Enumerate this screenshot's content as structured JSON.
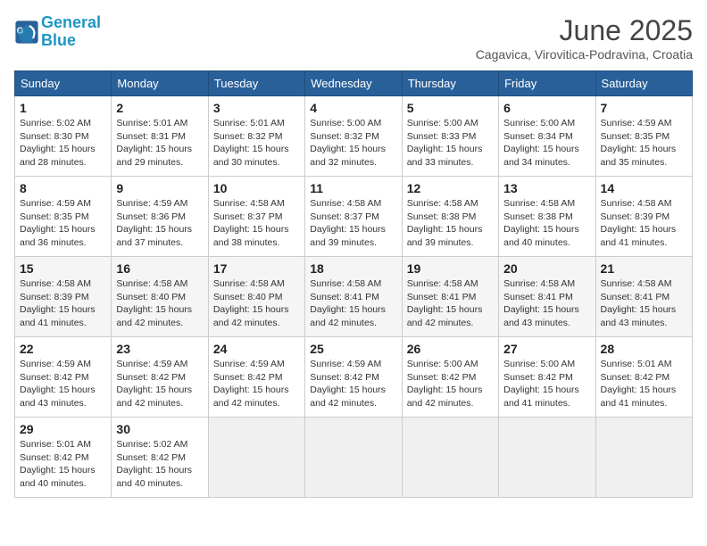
{
  "header": {
    "logo_line1": "General",
    "logo_line2": "Blue",
    "month_title": "June 2025",
    "location": "Cagavica, Virovitica-Podravina, Croatia"
  },
  "weekdays": [
    "Sunday",
    "Monday",
    "Tuesday",
    "Wednesday",
    "Thursday",
    "Friday",
    "Saturday"
  ],
  "days": [
    {
      "num": "",
      "info": ""
    },
    {
      "num": "",
      "info": ""
    },
    {
      "num": "",
      "info": ""
    },
    {
      "num": "",
      "info": ""
    },
    {
      "num": "",
      "info": ""
    },
    {
      "num": "",
      "info": ""
    },
    {
      "num": "",
      "info": ""
    },
    {
      "num": "1",
      "info": "Sunrise: 5:02 AM\nSunset: 8:30 PM\nDaylight: 15 hours\nand 28 minutes."
    },
    {
      "num": "2",
      "info": "Sunrise: 5:01 AM\nSunset: 8:31 PM\nDaylight: 15 hours\nand 29 minutes."
    },
    {
      "num": "3",
      "info": "Sunrise: 5:01 AM\nSunset: 8:32 PM\nDaylight: 15 hours\nand 30 minutes."
    },
    {
      "num": "4",
      "info": "Sunrise: 5:00 AM\nSunset: 8:32 PM\nDaylight: 15 hours\nand 32 minutes."
    },
    {
      "num": "5",
      "info": "Sunrise: 5:00 AM\nSunset: 8:33 PM\nDaylight: 15 hours\nand 33 minutes."
    },
    {
      "num": "6",
      "info": "Sunrise: 5:00 AM\nSunset: 8:34 PM\nDaylight: 15 hours\nand 34 minutes."
    },
    {
      "num": "7",
      "info": "Sunrise: 4:59 AM\nSunset: 8:35 PM\nDaylight: 15 hours\nand 35 minutes."
    },
    {
      "num": "8",
      "info": "Sunrise: 4:59 AM\nSunset: 8:35 PM\nDaylight: 15 hours\nand 36 minutes."
    },
    {
      "num": "9",
      "info": "Sunrise: 4:59 AM\nSunset: 8:36 PM\nDaylight: 15 hours\nand 37 minutes."
    },
    {
      "num": "10",
      "info": "Sunrise: 4:58 AM\nSunset: 8:37 PM\nDaylight: 15 hours\nand 38 minutes."
    },
    {
      "num": "11",
      "info": "Sunrise: 4:58 AM\nSunset: 8:37 PM\nDaylight: 15 hours\nand 39 minutes."
    },
    {
      "num": "12",
      "info": "Sunrise: 4:58 AM\nSunset: 8:38 PM\nDaylight: 15 hours\nand 39 minutes."
    },
    {
      "num": "13",
      "info": "Sunrise: 4:58 AM\nSunset: 8:38 PM\nDaylight: 15 hours\nand 40 minutes."
    },
    {
      "num": "14",
      "info": "Sunrise: 4:58 AM\nSunset: 8:39 PM\nDaylight: 15 hours\nand 41 minutes."
    },
    {
      "num": "15",
      "info": "Sunrise: 4:58 AM\nSunset: 8:39 PM\nDaylight: 15 hours\nand 41 minutes."
    },
    {
      "num": "16",
      "info": "Sunrise: 4:58 AM\nSunset: 8:40 PM\nDaylight: 15 hours\nand 42 minutes."
    },
    {
      "num": "17",
      "info": "Sunrise: 4:58 AM\nSunset: 8:40 PM\nDaylight: 15 hours\nand 42 minutes."
    },
    {
      "num": "18",
      "info": "Sunrise: 4:58 AM\nSunset: 8:41 PM\nDaylight: 15 hours\nand 42 minutes."
    },
    {
      "num": "19",
      "info": "Sunrise: 4:58 AM\nSunset: 8:41 PM\nDaylight: 15 hours\nand 42 minutes."
    },
    {
      "num": "20",
      "info": "Sunrise: 4:58 AM\nSunset: 8:41 PM\nDaylight: 15 hours\nand 43 minutes."
    },
    {
      "num": "21",
      "info": "Sunrise: 4:58 AM\nSunset: 8:41 PM\nDaylight: 15 hours\nand 43 minutes."
    },
    {
      "num": "22",
      "info": "Sunrise: 4:59 AM\nSunset: 8:42 PM\nDaylight: 15 hours\nand 43 minutes."
    },
    {
      "num": "23",
      "info": "Sunrise: 4:59 AM\nSunset: 8:42 PM\nDaylight: 15 hours\nand 42 minutes."
    },
    {
      "num": "24",
      "info": "Sunrise: 4:59 AM\nSunset: 8:42 PM\nDaylight: 15 hours\nand 42 minutes."
    },
    {
      "num": "25",
      "info": "Sunrise: 4:59 AM\nSunset: 8:42 PM\nDaylight: 15 hours\nand 42 minutes."
    },
    {
      "num": "26",
      "info": "Sunrise: 5:00 AM\nSunset: 8:42 PM\nDaylight: 15 hours\nand 42 minutes."
    },
    {
      "num": "27",
      "info": "Sunrise: 5:00 AM\nSunset: 8:42 PM\nDaylight: 15 hours\nand 41 minutes."
    },
    {
      "num": "28",
      "info": "Sunrise: 5:01 AM\nSunset: 8:42 PM\nDaylight: 15 hours\nand 41 minutes."
    },
    {
      "num": "29",
      "info": "Sunrise: 5:01 AM\nSunset: 8:42 PM\nDaylight: 15 hours\nand 40 minutes."
    },
    {
      "num": "30",
      "info": "Sunrise: 5:02 AM\nSunset: 8:42 PM\nDaylight: 15 hours\nand 40 minutes."
    },
    {
      "num": "",
      "info": ""
    },
    {
      "num": "",
      "info": ""
    },
    {
      "num": "",
      "info": ""
    },
    {
      "num": "",
      "info": ""
    },
    {
      "num": "",
      "info": ""
    }
  ]
}
